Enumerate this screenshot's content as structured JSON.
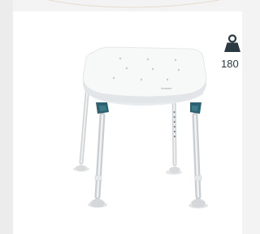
{
  "product": {
    "image_name": "shower-stool",
    "brand_mark": "invacare",
    "max_load": "180"
  },
  "colors": {
    "background": "#f3f3f3",
    "card": "#ffffff",
    "accent": "#2e6270",
    "icon_dark": "#2b3a42"
  }
}
